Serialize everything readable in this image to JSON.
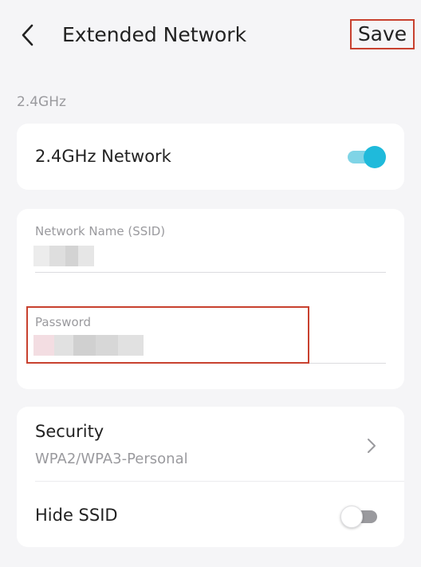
{
  "header": {
    "title": "Extended Network",
    "save_label": "Save"
  },
  "section": {
    "band_label": "2.4GHz"
  },
  "network_card": {
    "label": "2.4GHz Network",
    "enabled": true
  },
  "credentials": {
    "ssid_label": "Network Name (SSID)",
    "ssid_value_masked": true,
    "password_label": "Password",
    "password_value_masked": true
  },
  "settings": {
    "security_label": "Security",
    "security_value": "WPA2/WPA3-Personal",
    "hide_ssid_label": "Hide SSID",
    "hide_ssid_enabled": false
  },
  "colors": {
    "accent": "#1fbadb",
    "highlight": "#c8412f",
    "background": "#f5f5f7"
  }
}
